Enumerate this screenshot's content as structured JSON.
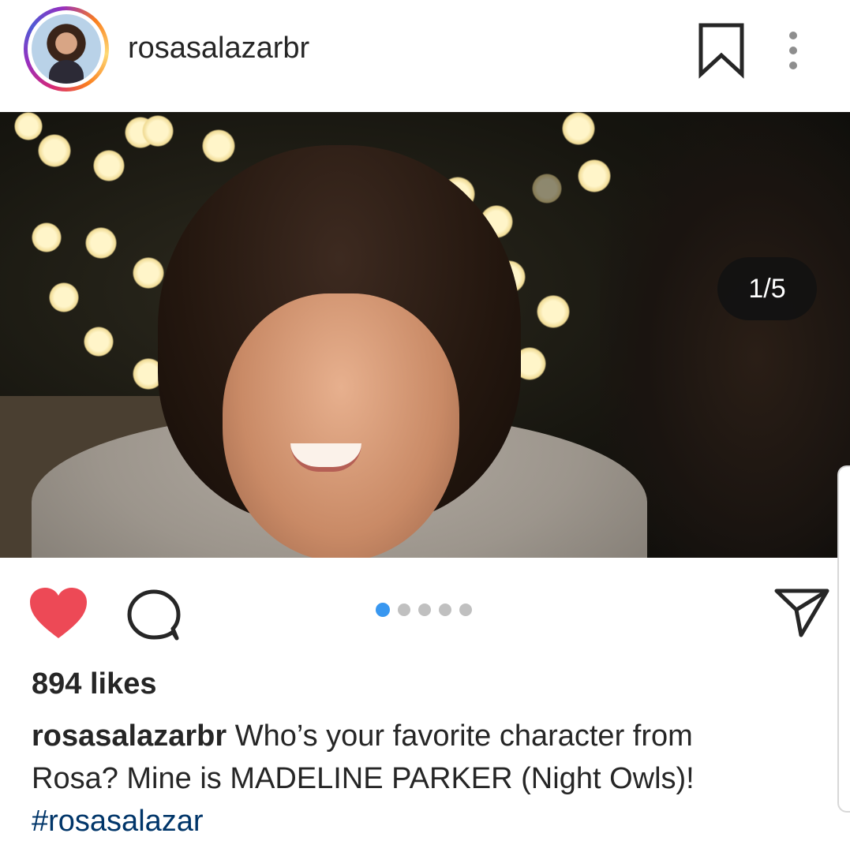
{
  "post": {
    "username": "rosasalazarbr",
    "media_counter": "1/5",
    "carousel": {
      "count": 5,
      "active_index": 0
    },
    "likes": "894 likes",
    "caption": {
      "username": "rosasalazarbr",
      "line1": "Who’s your favorite character from",
      "line2": "Rosa? Mine is MADELINE PARKER (Night Owls)!",
      "hashtag": "#rosasalazar"
    },
    "liked": true
  },
  "icons": {
    "header": [
      "bookmark-icon",
      "more-options-icon"
    ],
    "actions": [
      "heart-icon",
      "comment-icon",
      "share-icon"
    ]
  },
  "colors": {
    "heart": "#ed4956",
    "active_dot": "#3897f0",
    "inactive_dot": "#c0c0c0",
    "hashtag": "#003569",
    "text": "#262626"
  }
}
